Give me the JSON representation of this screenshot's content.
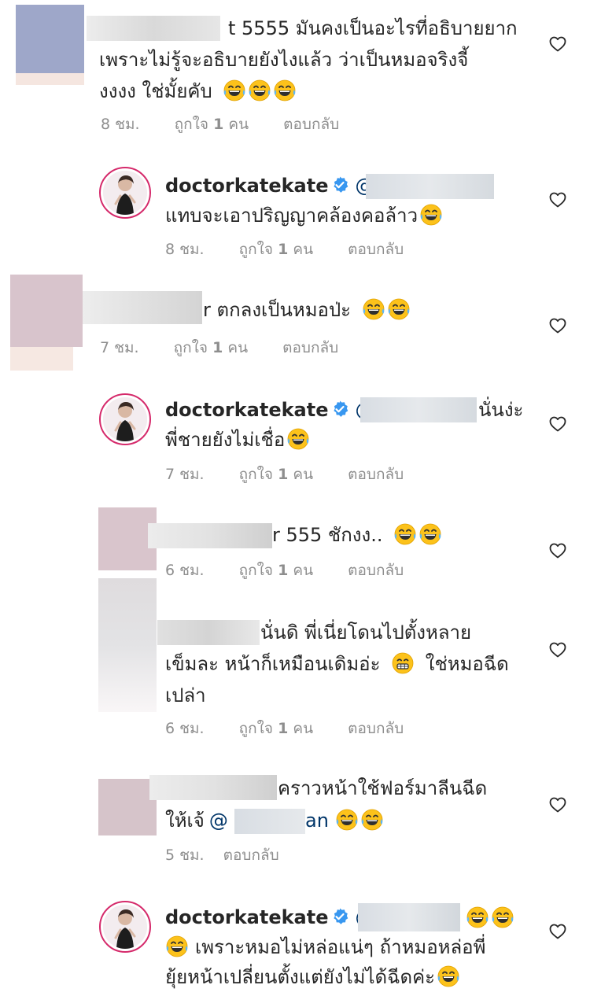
{
  "comments": [
    {
      "id": "c1",
      "lines": [
        "t 5555 มันคงเป็นอะไรที่อธิบายยาก",
        "เพราะไม่รู้จะอธิบายยังไงแล้ว ว่าเป็นหมอจริงจี้",
        "งงงง ใช่มั้ยคับ"
      ],
      "time": "8 ชม.",
      "likes_prefix": "ถูกใจ",
      "likes_count": "1",
      "likes_suffix": "คน",
      "reply": "ตอบกลับ"
    },
    {
      "id": "c2",
      "user": "doctorkatekate",
      "at": "@",
      "lines": [
        "แทบจะเอาปริญญาคล้องคอล้าว"
      ],
      "time": "8 ชม.",
      "likes_prefix": "ถูกใจ",
      "likes_count": "1",
      "likes_suffix": "คน",
      "reply": "ตอบกลับ"
    },
    {
      "id": "c3",
      "lines": [
        "r ตกลงเป็นหมอป่ะ"
      ],
      "time": "7 ชม.",
      "likes_prefix": "ถูกใจ",
      "likes_count": "1",
      "likes_suffix": "คน",
      "reply": "ตอบกลับ"
    },
    {
      "id": "c4",
      "user": "doctorkatekate",
      "at": "@",
      "line1_tail": "นั่นง่ะ",
      "lines": [
        "พี่ชายยังไม่เชื่อ"
      ],
      "time": "7 ชม.",
      "likes_prefix": "ถูกใจ",
      "likes_count": "1",
      "likes_suffix": "คน",
      "reply": "ตอบกลับ"
    },
    {
      "id": "c5",
      "lines": [
        "r 555  ชักงง.."
      ],
      "time": "6 ชม.",
      "likes_prefix": "ถูกใจ",
      "likes_count": "1",
      "likes_suffix": "คน",
      "reply": "ตอบกลับ"
    },
    {
      "id": "c6",
      "lines": [
        "นั่นดิ พี่เนี่ยโดนไปตั้งหลาย",
        "เข็มละ หน้าก็เหมือนเดิมอ่ะ",
        "ใช่หมอฉีด",
        "เปล่า"
      ],
      "time": "6 ชม.",
      "likes_prefix": "ถูกใจ",
      "likes_count": "1",
      "likes_suffix": "คน",
      "reply": "ตอบกลับ"
    },
    {
      "id": "c7",
      "lines": [
        "คราวหน้าใช้ฟอร์มาลีนฉีด",
        "ให้เจ้",
        "@",
        "an"
      ],
      "time": "5 ชม.",
      "reply": "ตอบกลับ"
    },
    {
      "id": "c8",
      "user": "doctorkatekate",
      "at": "@",
      "lines": [
        "เพราะหมอไม่หล่อแน่ๆ ถ้าหมอหล่อพี่",
        "ยุ้ยหน้าเปลี่ยนตั้งแต่ยังไม่ได้ฉีดค่ะ"
      ]
    }
  ],
  "icons": {
    "heart": "heart-outline-icon",
    "verified": "verified-badge-icon",
    "emoji_laugh": "tears-of-joy-emoji",
    "emoji_grin": "grinning-emoji"
  },
  "colors": {
    "text": "#262626",
    "meta": "#8e8e8e",
    "mention": "#003569",
    "verified": "#3897f0",
    "avatar_ring": "#d52a6b"
  }
}
